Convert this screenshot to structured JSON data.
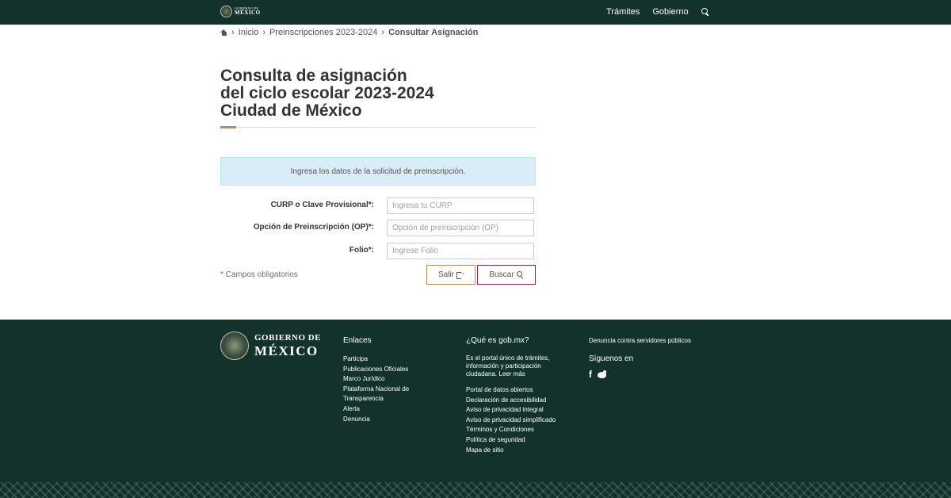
{
  "header": {
    "logo_line1": "GOBIERNO DE",
    "logo_line2": "MÉXICO",
    "nav": [
      "Trámites",
      "Gobierno"
    ]
  },
  "breadcrumb": {
    "items": [
      "Inicio",
      "Preinscripciones 2023-2024"
    ],
    "current": "Consultar Asignación"
  },
  "page": {
    "title_lines": [
      "Consulta de asignación",
      "del ciclo escolar 2023-2024",
      "Ciudad de México"
    ]
  },
  "alert": {
    "text": "Ingresa los datos de la solicitud de preinscripción."
  },
  "form": {
    "fields": [
      {
        "label": "CURP o Clave Provisional*:",
        "placeholder": "Ingresa tu CURP"
      },
      {
        "label": "Opción de Preinscripción (OP)*:",
        "placeholder": "Opción de preinscripción (OP)"
      },
      {
        "label": "Folio*:",
        "placeholder": "Ingrese Folio"
      }
    ],
    "required_note": "* Campos obligatorios",
    "exit_label": "Salir",
    "search_label": "Buscar"
  },
  "footer": {
    "logo_line1": "GOBIERNO DE",
    "logo_line2": "MÉXICO",
    "enlaces": {
      "title": "Enlaces",
      "items": [
        "Participa",
        "Publicaciones Oficiales",
        "Marco Jurídico",
        "Plataforma Nacional de Transparencia",
        "Alerta",
        "Denuncia"
      ]
    },
    "gob": {
      "title": "¿Qué es gob.mx?",
      "description": "Es el portal único de trámites, información y participación ciudadana. Leer más",
      "items": [
        "Portal de datos abiertos",
        "Declaración de accesibilidad",
        "Aviso de privacidad integral",
        "Aviso de privacidad simplificado",
        "Términos y Condiciones",
        "Política de seguridad",
        "Mapa de sitio"
      ]
    },
    "right": {
      "denuncia": "Denuncia contra servidores públicos",
      "siguenos": "Síguenos en",
      "social_icons": [
        "facebook-icon",
        "twitter-icon"
      ]
    }
  },
  "colors": {
    "primary_dark": "#13322b",
    "accent_gold": "#b38e5d",
    "accent_wine": "#9d2449",
    "alert_bg": "#d9edf7"
  }
}
